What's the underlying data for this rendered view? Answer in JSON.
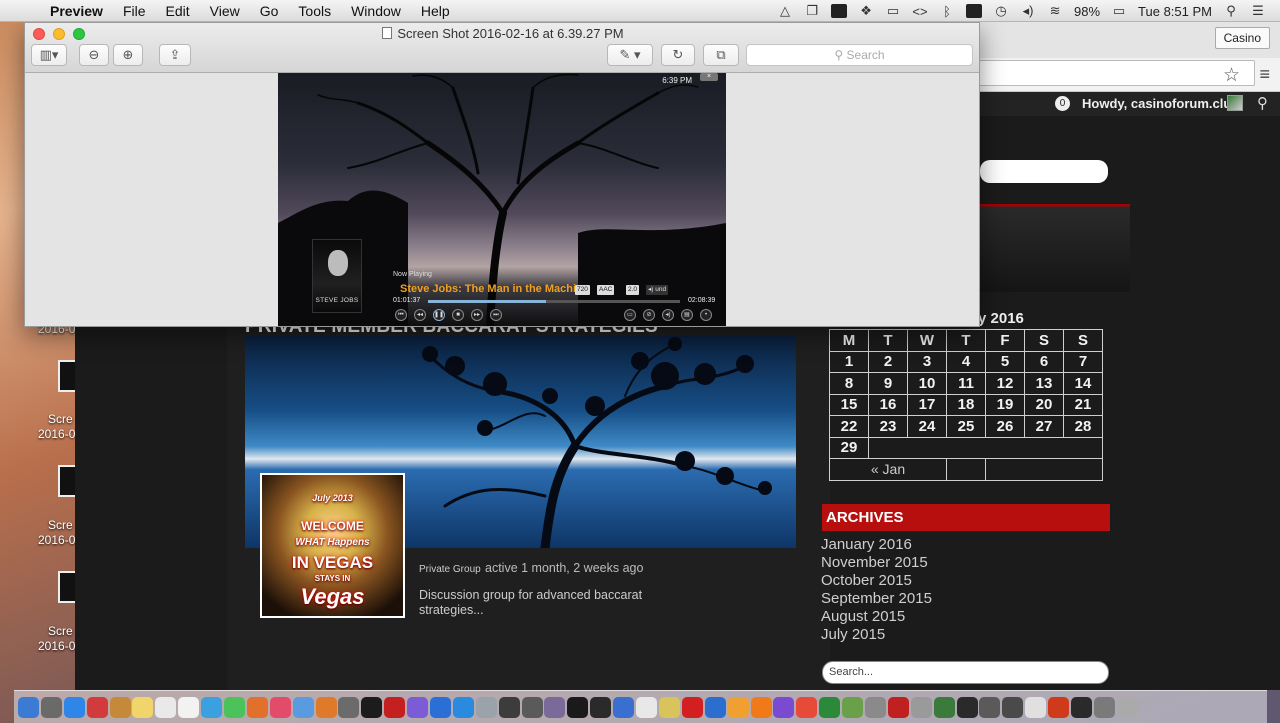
{
  "menubar": {
    "app_name": "Preview",
    "menus": [
      "File",
      "Edit",
      "View",
      "Go",
      "Tools",
      "Window",
      "Help"
    ],
    "battery": "98%",
    "clock": "Tue 8:51 PM"
  },
  "desktop": {
    "icons": [
      {
        "label1": "",
        "label2": "2016-0"
      },
      {
        "label1": "Scre",
        "label2": "2016-0"
      },
      {
        "label1": "Scre",
        "label2": "2016-0"
      },
      {
        "label1": "Scre",
        "label2": "2016-0"
      }
    ]
  },
  "preview": {
    "title": "Screen Shot 2016-02-16 at 6.39.27 PM",
    "search_placeholder": "Search",
    "screenshot": {
      "clock": "6:39 PM",
      "poster_label": "STEVE JOBS",
      "now_playing_label": "Now Playing",
      "track_title": "Steve Jobs: The Man in the Machine",
      "badges": [
        "720",
        "AAC",
        "2.0",
        "und"
      ],
      "elapsed": "01:01:37",
      "remaining": "02:08:39",
      "progress_fraction": 0.47
    }
  },
  "browser": {
    "tab_label": "Casino",
    "admin_bar": {
      "notifications": "0",
      "howdy": "Howdy, casinoforum.club"
    },
    "group": {
      "title": "PRIVATE MEMBER BACCARAT STRATEGIES",
      "avatar_text": {
        "year": "July 2013",
        "line1": "WELCOME",
        "line2": "WHAT Happens",
        "line3": "IN VEGAS",
        "line4": "STAYS IN",
        "line5": "Vegas"
      },
      "type": "Private Group",
      "active": "active 1 month, 2 weeks ago",
      "description": "Discussion group for advanced baccarat strategies..."
    },
    "calendar": {
      "caption": "y 2016",
      "weekdays": [
        "M",
        "T",
        "W",
        "T",
        "F",
        "S",
        "S"
      ],
      "weeks": [
        [
          "1",
          "2",
          "3",
          "4",
          "5",
          "6",
          "7"
        ],
        [
          "8",
          "9",
          "10",
          "11",
          "12",
          "13",
          "14"
        ],
        [
          "15",
          "16",
          "17",
          "18",
          "19",
          "20",
          "21"
        ],
        [
          "22",
          "23",
          "24",
          "25",
          "26",
          "27",
          "28"
        ],
        [
          "29",
          "",
          "",
          "",
          "",
          "",
          ""
        ]
      ],
      "prev_link": "« Jan"
    },
    "archives": {
      "heading": "ARCHIVES",
      "items": [
        "January 2016",
        "November 2015",
        "October 2015",
        "September 2015",
        "August 2015",
        "July 2015"
      ]
    },
    "search_placeholder": "Search..."
  }
}
